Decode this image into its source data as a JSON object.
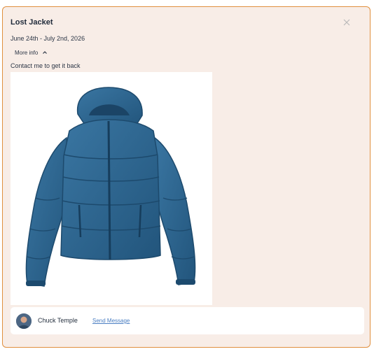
{
  "card": {
    "title": "Lost Jacket",
    "dates": "June 24th - July 2nd, 2026",
    "more_info_label": "More info",
    "description": "Contact me to get it back",
    "close_icon": "close-icon",
    "photo_alt": "Blue puffer jacket"
  },
  "footer": {
    "owner_name": "Chuck Temple",
    "send_message_label": "Send Message"
  },
  "colors": {
    "card_bg": "#f8ede7",
    "card_border": "#e0903f",
    "link": "#4a7ec2",
    "jacket": "#2b628d"
  }
}
